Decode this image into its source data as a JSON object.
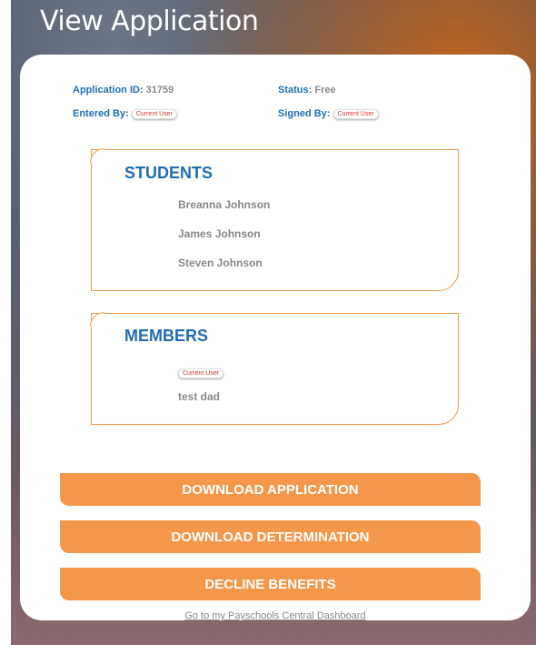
{
  "page": {
    "title": "View Application"
  },
  "application": {
    "id_label": "Application ID:",
    "id_value": "31759",
    "status_label": "Status:",
    "status_value": "Free",
    "entered_by_label": "Entered By:",
    "entered_by_value": "Current User",
    "signed_by_label": "Signed By:",
    "signed_by_value": "Current User"
  },
  "students": {
    "heading": "STUDENTS",
    "items": [
      "Breanna Johnson",
      "James Johnson",
      "Steven Johnson"
    ]
  },
  "members": {
    "heading": "MEMBERS",
    "badge": "Current User",
    "items": [
      "test dad"
    ]
  },
  "actions": {
    "download_application": "DOWNLOAD APPLICATION",
    "download_determination": "DOWNLOAD DETERMINATION",
    "decline_benefits": "DECLINE BENEFITS",
    "dashboard_link": "Go to my Payschools Central Dashboard"
  },
  "colors": {
    "accent_blue": "#1f6eb4",
    "accent_orange": "#f5974a",
    "muted_text": "#888888"
  }
}
